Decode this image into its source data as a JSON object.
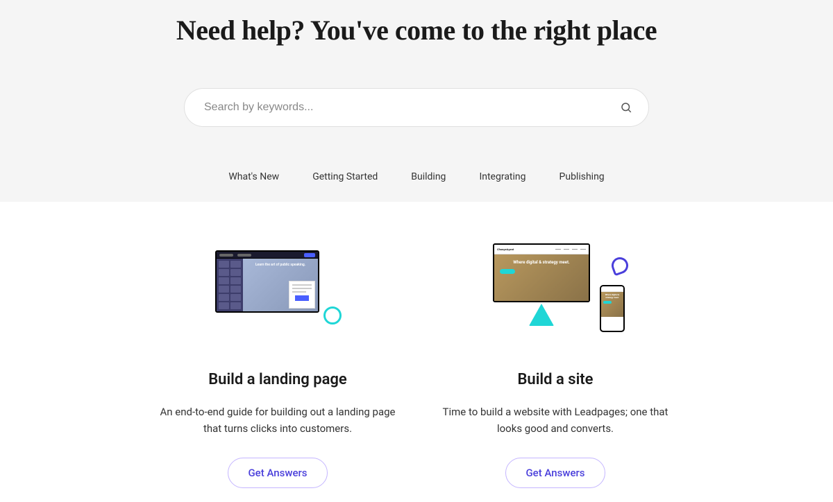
{
  "hero": {
    "title": "Need help? You've come to the right place",
    "search_placeholder": "Search by keywords..."
  },
  "nav": {
    "items": [
      {
        "label": "What's New"
      },
      {
        "label": "Getting Started"
      },
      {
        "label": "Building"
      },
      {
        "label": "Integrating"
      },
      {
        "label": "Publishing"
      }
    ]
  },
  "cards": [
    {
      "title": "Build a landing page",
      "description": "An end-to-end guide for building out a landing page that turns clicks into customers.",
      "button_label": "Get Answers",
      "illus": {
        "headline": "Learn the art of public speaking."
      }
    },
    {
      "title": "Build a site",
      "description": "Time to build a website with Leadpages; one that looks good and converts.",
      "button_label": "Get Answers",
      "illus": {
        "brand": "ChangeAgent",
        "headline": "Where digital & strategy meet."
      }
    }
  ]
}
